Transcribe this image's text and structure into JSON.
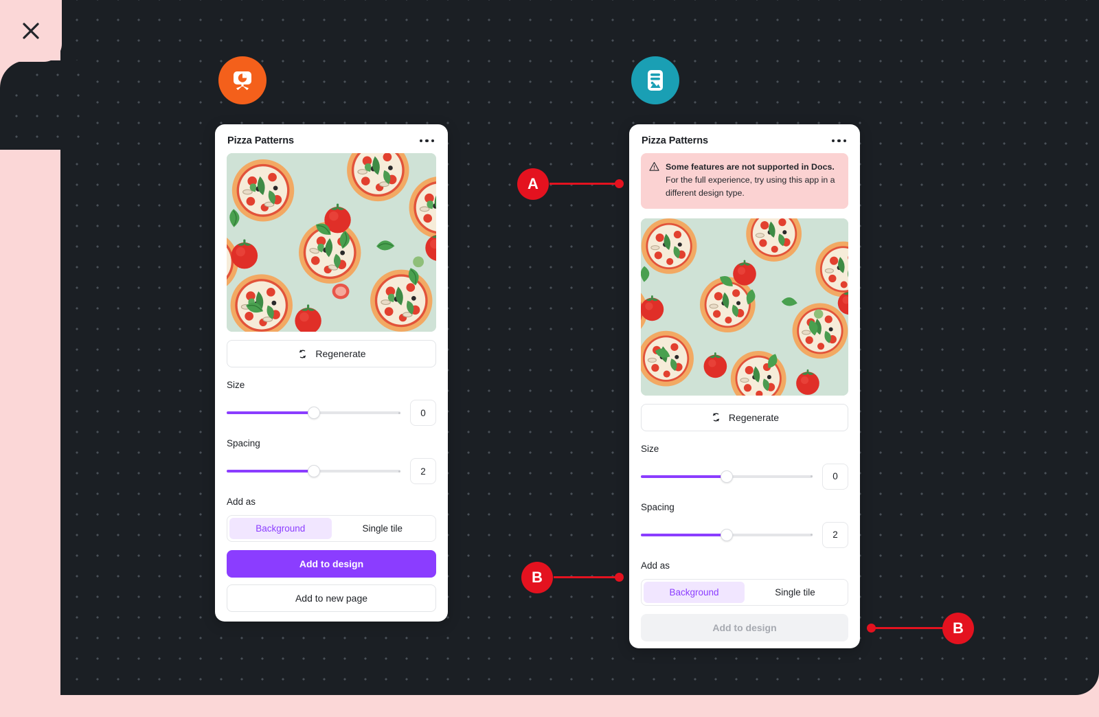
{
  "window": {
    "close_label": "Close",
    "close_icon": "close-x-icon"
  },
  "apps": [
    {
      "id": "presentation",
      "icon": "presentation-chart-icon",
      "color": "#f4601b"
    },
    {
      "id": "docs",
      "icon": "document-image-icon",
      "color": "#1a9fb4"
    }
  ],
  "panel_left": {
    "title": "Pizza Patterns",
    "overflow_icon": "more-options-icon",
    "regenerate_label": "Regenerate",
    "regenerate_icon": "refresh-icon",
    "size_label": "Size",
    "size_value": "0",
    "size_percent": 50,
    "spacing_label": "Spacing",
    "spacing_value": "2",
    "spacing_percent": 50,
    "add_as_label": "Add as",
    "seg_background": "Background",
    "seg_single_tile": "Single tile",
    "primary_button": "Add to design",
    "secondary_button": "Add to new page"
  },
  "panel_right": {
    "title": "Pizza Patterns",
    "overflow_icon": "more-options-icon",
    "warning_icon": "warning-triangle-icon",
    "warning_strong": "Some features are not supported in Docs.",
    "warning_rest": " For the full experience, try using this app in a different design type.",
    "regenerate_label": "Regenerate",
    "regenerate_icon": "refresh-icon",
    "size_label": "Size",
    "size_value": "0",
    "size_percent": 50,
    "spacing_label": "Spacing",
    "spacing_value": "2",
    "spacing_percent": 50,
    "add_as_label": "Add as",
    "seg_background": "Background",
    "seg_single_tile": "Single tile",
    "primary_button": "Add to design"
  },
  "annotations": [
    {
      "label": "A",
      "target": "warning-banner"
    },
    {
      "label": "B",
      "target": "add-as-segment"
    },
    {
      "label": "B",
      "target": "add-to-design-disabled"
    }
  ],
  "colors": {
    "accent_purple": "#8b3dff",
    "marker_red": "#e4121f",
    "canvas_dark": "#1b1f24",
    "frame_pink": "#fbd7d7",
    "warning_bg": "#fbd2d2",
    "pattern_bg": "#cfe2d6"
  }
}
